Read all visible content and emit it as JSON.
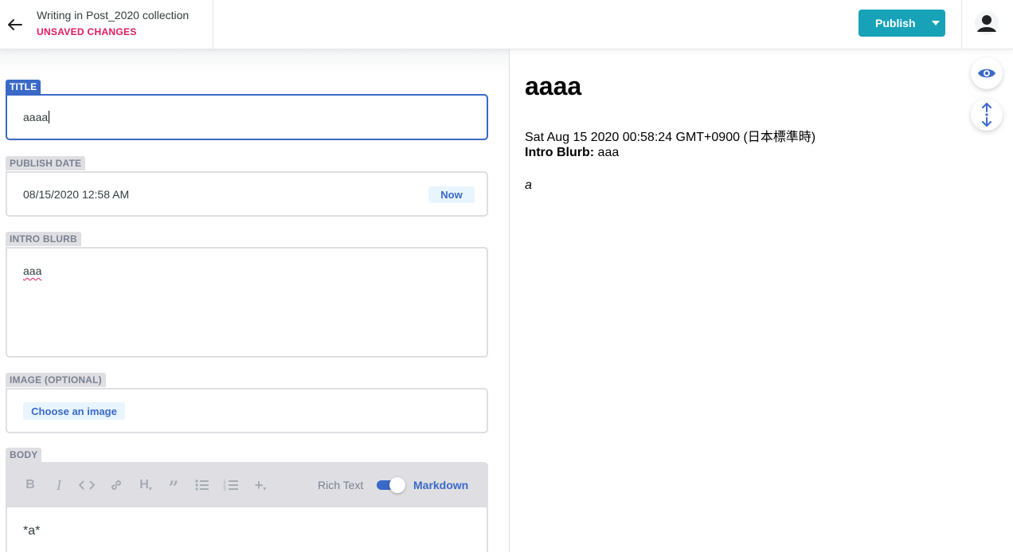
{
  "header": {
    "title": "Writing in Post_2020 collection",
    "status": "UNSAVED CHANGES",
    "publish_label": "Publish"
  },
  "fields": {
    "title": {
      "label": "TITLE",
      "value": "aaaa"
    },
    "publish_date": {
      "label": "PUBLISH DATE",
      "value": "08/15/2020 12:58 AM",
      "now_label": "Now"
    },
    "intro_blurb": {
      "label": "INTRO BLURB",
      "value": "aaa"
    },
    "image": {
      "label": "IMAGE (OPTIONAL)",
      "button_label": "Choose an image"
    },
    "body": {
      "label": "BODY",
      "value": "*a*",
      "mode_rich": "Rich Text",
      "mode_markdown": "Markdown",
      "toolbar": [
        "bold-icon",
        "italic-icon",
        "code-icon",
        "link-icon",
        "heading-icon",
        "quote-icon",
        "bulleted-list-icon",
        "numbered-list-icon",
        "add-icon"
      ]
    }
  },
  "preview": {
    "title": "aaaa",
    "date": "Sat Aug 15 2020 00:58:24 GMT+0900 (日本標準時)",
    "blurb_label": "Intro Blurb:",
    "blurb_value": " aaa",
    "body": "a"
  },
  "colors": {
    "accent": "#3a69c7",
    "publish": "#17a2b8",
    "unsaved": "#e01a5a"
  }
}
